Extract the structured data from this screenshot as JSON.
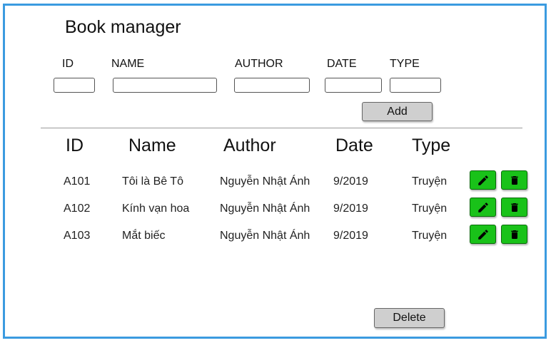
{
  "page": {
    "title": "Book manager"
  },
  "form": {
    "labels": {
      "id": "ID",
      "name": "NAME",
      "author": "AUTHOR",
      "date": "DATE",
      "type": "TYPE"
    },
    "values": {
      "id": "",
      "name": "",
      "author": "",
      "date": "",
      "type": ""
    },
    "add_label": "Add"
  },
  "table": {
    "headers": {
      "id": "ID",
      "name": "Name",
      "author": "Author",
      "date": "Date",
      "type": "Type"
    },
    "rows": [
      {
        "id": "A101",
        "name": "Tôi là Bê Tô",
        "author": "Nguyễn Nhật Ánh",
        "date": "9/2019",
        "type": "Truyện"
      },
      {
        "id": "A102",
        "name": "Kính vạn hoa",
        "author": "Nguyễn Nhật Ánh",
        "date": "9/2019",
        "type": "Truyện"
      },
      {
        "id": "A103",
        "name": "Mắt biếc",
        "author": "Nguyễn Nhật Ánh",
        "date": "9/2019",
        "type": "Truyện"
      }
    ]
  },
  "footer": {
    "delete_label": "Delete"
  },
  "icons": {
    "edit": "pencil-icon",
    "delete": "trash-icon"
  },
  "colors": {
    "frame": "#3b9be0",
    "action_button": "#19c219",
    "button": "#cfcfcf"
  }
}
